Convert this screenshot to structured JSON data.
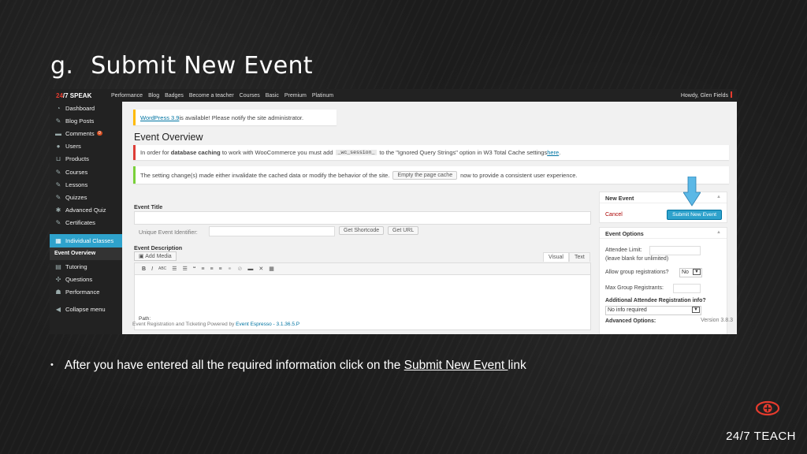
{
  "slide": {
    "number": "g.",
    "title": "Submit New Event",
    "bullet_text": "After you have entered all the required information click  on the",
    "bullet_link": "Submit New Event ",
    "bullet_tail": "link",
    "brand": "24/7 TEACH"
  },
  "adminbar": {
    "logo_left": "24",
    "logo_mid": "/7",
    "logo_right": " SPEAK",
    "menu": [
      "Performance",
      "Blog",
      "Badges",
      "Become a teacher",
      "Courses",
      "Basic",
      "Premium",
      "Platinum"
    ],
    "howdy": "Howdy, Glen Fields"
  },
  "sidebar": {
    "items": [
      {
        "label": "Dashboard",
        "icon": "dashboard-icon",
        "glyph": "◔"
      },
      {
        "label": "Blog Posts",
        "icon": "pin-icon",
        "glyph": "✎"
      },
      {
        "label": "Comments",
        "icon": "comment-icon",
        "glyph": "▬",
        "badge": "0"
      },
      {
        "label": "Users",
        "icon": "user-icon",
        "glyph": "●"
      },
      {
        "label": "Products",
        "icon": "cart-icon",
        "glyph": "⊔"
      },
      {
        "label": "Courses",
        "icon": "pin-icon",
        "glyph": "✎"
      },
      {
        "label": "Lessons",
        "icon": "pin-icon",
        "glyph": "✎"
      },
      {
        "label": "Quizzes",
        "icon": "pin-icon",
        "glyph": "✎"
      },
      {
        "label": "Advanced Quiz",
        "icon": "gear-icon",
        "glyph": "✱"
      },
      {
        "label": "Certificates",
        "icon": "pin-icon",
        "glyph": "✎"
      },
      {
        "label": "Individual Classes",
        "icon": "calendar-icon",
        "glyph": "▦"
      },
      {
        "label": "Event Overview"
      },
      {
        "label": "Tutoring",
        "icon": "tutoring-icon",
        "glyph": "▤"
      },
      {
        "label": "Questions",
        "icon": "question-icon",
        "glyph": "✣"
      },
      {
        "label": "Performance",
        "icon": "performance-icon",
        "glyph": "☗"
      },
      {
        "label": "Collapse menu",
        "icon": "collapse-icon",
        "glyph": "◀"
      }
    ]
  },
  "notices": {
    "update_link": "WordPress 3.9",
    "update_text": " is available! Please notify the site administrator.",
    "cache_pre": "In order for ",
    "cache_bold": "database caching",
    "cache_mid": " to work with WooCommerce you must add ",
    "cache_code": "_wc_session_",
    "cache_post": " to the \"Ignored Query Strings\" option in W3 Total Cache settings ",
    "cache_link": "here",
    "cache_end": ".",
    "setting_pre": "The setting change(s) made either invalidate the cached data or modify the behavior of the site.",
    "setting_btn": "Empty the page cache",
    "setting_post": "now to provide a consistent user experience."
  },
  "page": {
    "heading": "Event Overview",
    "event_title_label": "Event Title",
    "unique_label": "Unique Event Identifier:",
    "get_shortcode": "Get Shortcode",
    "get_url": "Get URL",
    "desc_label": "Event Description",
    "add_media": "Add Media",
    "tab_visual": "Visual",
    "tab_text": "Text",
    "path": "Path:",
    "footer_pre": "Event Registration and Ticketing Powered by ",
    "footer_link": "Event Espresso - 3.1.36.5.P"
  },
  "new_event_box": {
    "title": "New Event",
    "cancel": "Cancel",
    "submit": "Submit New Event"
  },
  "options_box": {
    "title": "Event Options",
    "attendee_limit": "Attendee Limit:",
    "attendee_hint": "(leave blank for unlimited)",
    "group_reg": "Allow group registrations?",
    "group_reg_value": "No",
    "max_group": "Max Group Registrants:",
    "additional": "Additional Attendee Registration info?",
    "additional_value": "No info required",
    "advanced": "Advanced Options:",
    "version": "Version 3.8.3"
  },
  "colors": {
    "accent": "#2ea2cc",
    "arrow": "#5bb8e6",
    "brand_red": "#e63b2e"
  }
}
